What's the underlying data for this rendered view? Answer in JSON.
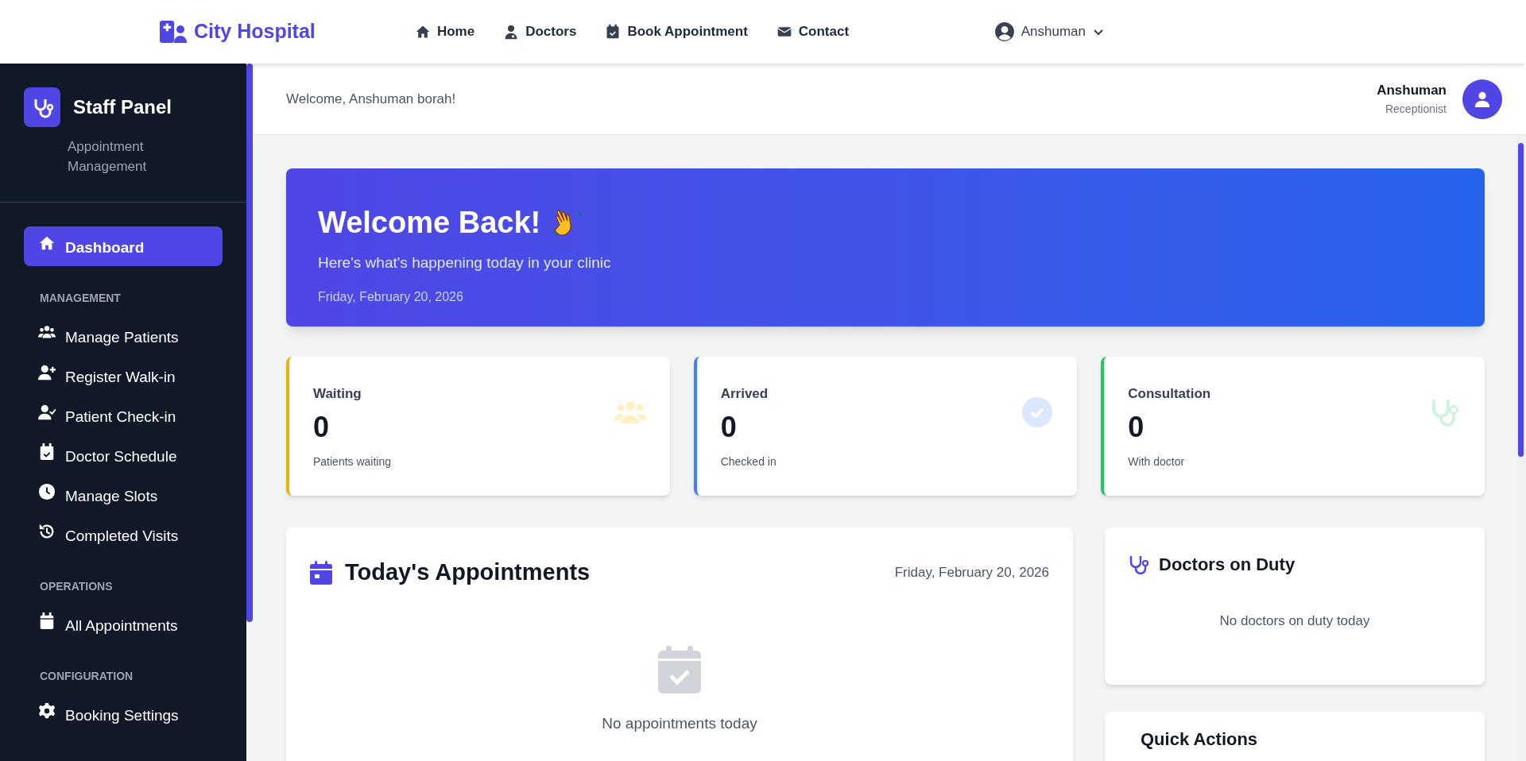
{
  "navbar": {
    "brand": "City Hospital",
    "links": [
      {
        "label": "Home"
      },
      {
        "label": "Doctors"
      },
      {
        "label": "Book Appointment"
      },
      {
        "label": "Contact"
      }
    ],
    "user": "Anshuman"
  },
  "sidebar": {
    "title": "Staff Panel",
    "subtitle": "Appointment Management",
    "items": [
      {
        "label": "Dashboard",
        "selected": true
      }
    ],
    "sections": [
      {
        "heading": "MANAGEMENT",
        "items": [
          {
            "label": "Manage Patients",
            "selected": false
          },
          {
            "label": "Register Walk-in",
            "selected": false
          },
          {
            "label": "Patient Check-in",
            "selected": false
          },
          {
            "label": "Doctor Schedule",
            "selected": false
          },
          {
            "label": "Manage Slots",
            "selected": false
          },
          {
            "label": "Completed Visits",
            "selected": false
          }
        ]
      },
      {
        "heading": "OPERATIONS",
        "items": [
          {
            "label": "All Appointments",
            "selected": false
          }
        ]
      },
      {
        "heading": "CONFIGURATION",
        "items": [
          {
            "label": "Booking Settings",
            "selected": false
          }
        ]
      }
    ]
  },
  "header": {
    "welcome": "Welcome, Anshuman borah!",
    "user_name": "Anshuman",
    "user_role": "Receptionist"
  },
  "banner": {
    "title": "Welcome Back!",
    "subtitle": "Here's what's happening today in your clinic",
    "date": "Friday, February 20, 2026"
  },
  "stats": [
    {
      "label": "Waiting",
      "value": "0",
      "caption": "Patients waiting",
      "color": "#eab308"
    },
    {
      "label": "Arrived",
      "value": "0",
      "caption": "Checked in",
      "color": "#3b82f6"
    },
    {
      "label": "Consultation",
      "value": "0",
      "caption": "With doctor",
      "color": "#22c55e"
    }
  ],
  "appointments": {
    "title": "Today's Appointments",
    "date": "Friday, February 20, 2026",
    "empty": "No appointments today"
  },
  "doctors_on_duty": {
    "title": "Doctors on Duty",
    "empty": "No doctors on duty today"
  },
  "quick_actions": {
    "title": "Quick Actions"
  }
}
